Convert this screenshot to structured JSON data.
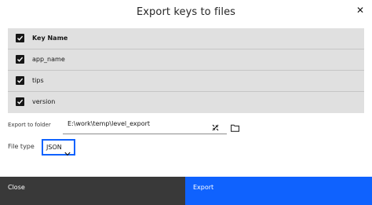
{
  "dialog": {
    "title": "Export keys to files",
    "close_icon": "close-icon"
  },
  "keys_table": {
    "header_label": "Key Name",
    "header_checked": true,
    "rows": [
      {
        "label": "app_name",
        "checked": true
      },
      {
        "label": "tips",
        "checked": true
      },
      {
        "label": "version",
        "checked": true
      }
    ]
  },
  "export_folder": {
    "label": "Export to folder",
    "value": "E:\\work\\temp\\level_export",
    "clear_icon": "clear-icon",
    "browse_icon": "folder-icon"
  },
  "file_type": {
    "label": "File type",
    "selected": "JSON"
  },
  "footer": {
    "close_label": "Close",
    "export_label": "Export"
  },
  "colors": {
    "primary": "#0f62fe",
    "secondary": "#393939",
    "table_bg": "#e0e0e0"
  }
}
